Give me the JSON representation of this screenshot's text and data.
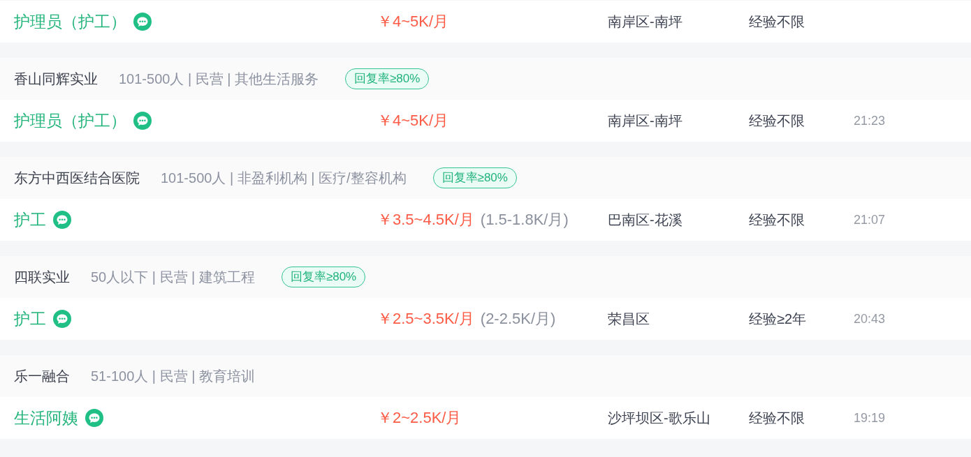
{
  "listings": [
    {
      "job": {
        "title": "护理员（护工）",
        "salary": "￥4~5K/月",
        "location": "南岸区-南坪",
        "experience": "经验不限"
      }
    },
    {
      "company": {
        "name": "香山同辉实业",
        "info": "101-500人 | 民营 | 其他生活服务",
        "badge": "回复率≥80%"
      },
      "job": {
        "title": "护理员（护工）",
        "salary": "￥4~5K/月",
        "location": "南岸区-南坪",
        "experience": "经验不限",
        "time": "21:23"
      }
    },
    {
      "company": {
        "name": "东方中西医结合医院",
        "info": "101-500人 | 非盈利机构 | 医疗/整容机构",
        "badge": "回复率≥80%"
      },
      "job": {
        "title": "护工",
        "salary": "￥3.5~4.5K/月",
        "salary_note": "(1.5-1.8K/月)",
        "location": "巴南区-花溪",
        "experience": "经验不限",
        "time": "21:07"
      }
    },
    {
      "company": {
        "name": "四联实业",
        "info": "50人以下 | 民营 | 建筑工程",
        "badge": "回复率≥80%"
      },
      "job": {
        "title": "护工",
        "salary": "￥2.5~3.5K/月",
        "salary_note": "(2-2.5K/月)",
        "location": "荣昌区",
        "experience": "经验≥2年",
        "time": "20:43"
      }
    },
    {
      "company": {
        "name": "乐一融合",
        "info": "51-100人 | 民营 | 教育培训"
      },
      "job": {
        "title": "生活阿姨",
        "salary": "￥2~2.5K/月",
        "location": "沙坪坝区-歌乐山",
        "experience": "经验不限",
        "time": "19:19"
      }
    }
  ]
}
